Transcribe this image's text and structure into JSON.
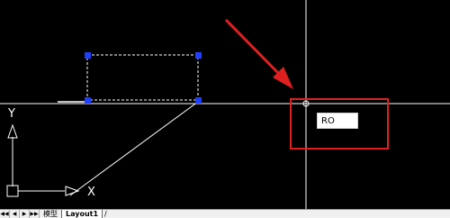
{
  "command_input": {
    "value": "RO"
  },
  "layout_tabs": {
    "nav_buttons": [
      "◀◀",
      "◀",
      "▶",
      "▶▶"
    ],
    "tabs": [
      "模型",
      "Layout1"
    ],
    "trailing": "/"
  },
  "ucs_icon": {
    "x_label": "X",
    "y_label": "Y"
  },
  "colors": {
    "background": "#000000",
    "crosshair": "#ffffff",
    "grip": "#1f3fff",
    "highlight_box": "#e02020",
    "arrow": "#e02020",
    "tab_bar": "#f0f0f0"
  }
}
